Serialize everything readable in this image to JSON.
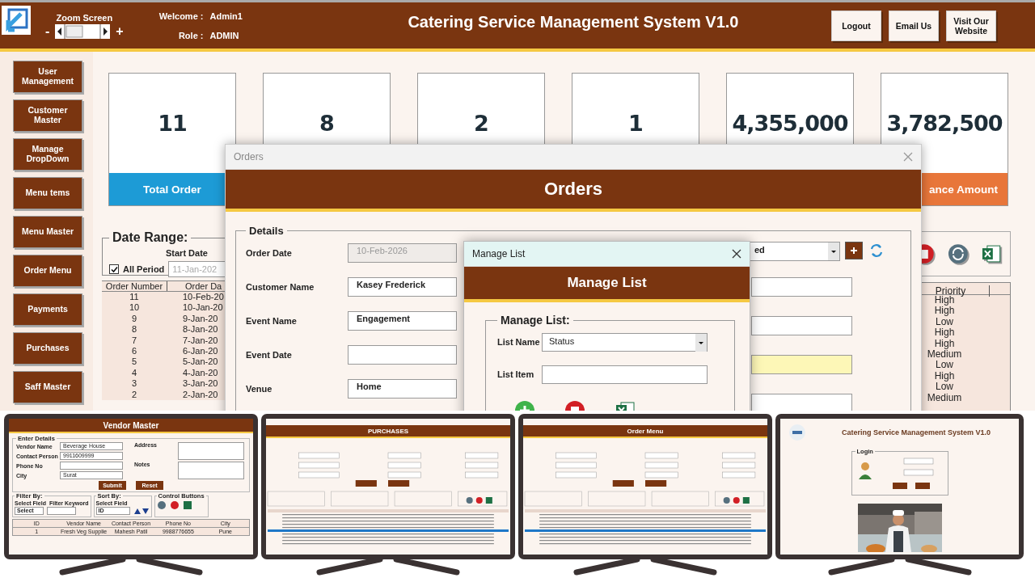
{
  "header": {
    "zoom_label": "Zoom Screen",
    "zoom_minus": "-",
    "zoom_plus": "+",
    "welcome_label": "Welcome :",
    "welcome_value": "Admin1",
    "role_label": "Role :",
    "role_value": "ADMIN",
    "title": "Catering Service Management System V1.0",
    "buttons": [
      "Logout",
      "Email Us",
      "Visit Our Website"
    ]
  },
  "sidebar": {
    "items": [
      "User Management",
      "Customer Master",
      "Manage DropDown",
      "Menu tems",
      "Menu Master",
      "Order Menu",
      "Payments",
      "Purchases",
      "Saff Master"
    ]
  },
  "cards": [
    {
      "value": "11",
      "label": "Total Order",
      "color": "#1d9bd6"
    },
    {
      "value": "8"
    },
    {
      "value": "2"
    },
    {
      "value": "1"
    },
    {
      "value": "4,355,000"
    },
    {
      "value": "3,782,500",
      "label": "ance Amount",
      "color": "#e8763a"
    }
  ],
  "date_range": {
    "title": "Date Range:",
    "start_label": "Start Date",
    "all_period": {
      "label": "All Period",
      "checked": true
    },
    "start_value": "11-Jan-202"
  },
  "orders_table": {
    "columns": [
      "Order Number",
      "Order Da"
    ],
    "rows": [
      [
        "11",
        "10-Feb-20"
      ],
      [
        "10",
        "10-Jan-20"
      ],
      [
        "9",
        "9-Jan-20"
      ],
      [
        "8",
        "8-Jan-20"
      ],
      [
        "7",
        "7-Jan-20"
      ],
      [
        "6",
        "6-Jan-20"
      ],
      [
        "5",
        "5-Jan-20"
      ],
      [
        "4",
        "4-Jan-20"
      ],
      [
        "3",
        "3-Jan-20"
      ],
      [
        "2",
        "2-Jan-20"
      ]
    ]
  },
  "priority_table": {
    "columns": [
      "Priority"
    ],
    "rows": [
      "High",
      "High",
      "Low",
      "High",
      "High",
      "Medium",
      "Low",
      "High",
      "Low",
      "Medium"
    ]
  },
  "orders_dialog": {
    "window_title": "Orders",
    "banner": "Orders",
    "section": "Details",
    "fields": [
      {
        "label": "Order Date",
        "value": "10-Feb-2026",
        "disabled": true
      },
      {
        "label": "Customer Name",
        "value": "Kasey Frederick",
        "disabled": false
      },
      {
        "label": "Event Name",
        "value": "Engagement",
        "disabled": false
      },
      {
        "label": "Event Date",
        "disabled": false
      },
      {
        "label": "Venue",
        "value": "Home",
        "disabled": false
      }
    ],
    "right_fields": [
      {
        "kind": "dropdown",
        "value": "ed",
        "highlighted": false
      },
      {
        "kind": "text",
        "highlighted": false
      },
      {
        "kind": "text",
        "highlighted": false
      },
      {
        "kind": "text",
        "highlighted": true
      },
      {
        "kind": "text",
        "highlighted": false
      }
    ]
  },
  "manage_list_dialog": {
    "window_title": "Manage List",
    "banner": "Manage List",
    "section": "Manage List:",
    "list_name_label": "List Name",
    "list_name_value": "Status",
    "list_item_label": "List Item"
  },
  "monitors": [
    {
      "kind": "vendor_master",
      "title": "Vendor Master",
      "section": "Enter Details",
      "fields": [
        {
          "label": "Vendor Name",
          "value": "Beverage House"
        },
        {
          "label": "Contact Person",
          "value": "9911609999"
        },
        {
          "label": "Phone No"
        },
        {
          "label": "City",
          "value": "Surat"
        }
      ],
      "side_fields": [
        "Address",
        "Notes"
      ],
      "buttons": [
        "Submit",
        "Reset"
      ],
      "filter": {
        "title": "Filter By:",
        "field_label": "Select Field",
        "field_value": "Select",
        "keyword_label": "Filter Keyword"
      },
      "sort": {
        "title": "Sort By:",
        "field_label": "Select Field",
        "field_value": "ID"
      },
      "control_title": "Control Buttons",
      "table": {
        "columns": [
          "ID",
          "Vendor Name",
          "Contact Person",
          "Phone No",
          "City"
        ],
        "rows": [
          [
            "1",
            "Fresh Veg Supplie",
            "Mahesh Patil",
            "9988776655",
            "Pune"
          ]
        ]
      }
    },
    {
      "kind": "purchases",
      "title": "PURCHASES"
    },
    {
      "kind": "order_menu",
      "title": "Order Menu"
    },
    {
      "kind": "login",
      "title": "Catering Service Management System V1.0",
      "section": "Login"
    }
  ]
}
